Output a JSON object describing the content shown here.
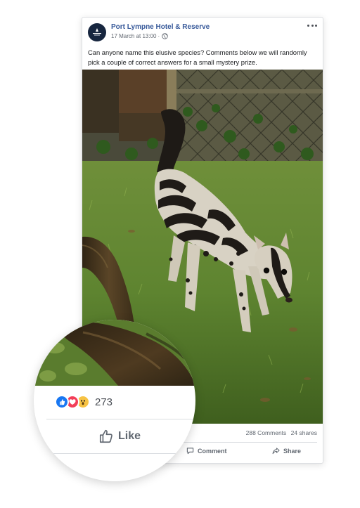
{
  "post": {
    "page_name": "Port Lympne Hotel & Reserve",
    "timestamp": "17 March at 13:00",
    "separator": "·",
    "privacy_icon": "globe-icon",
    "menu_icon": "more-options-icon",
    "text": "Can anyone name this elusive species? Comments below we will randomly pick a couple of correct answers for a small mystery prize.",
    "image_subject": "banded-civet-photo"
  },
  "engagement": {
    "comments": "288 Comments",
    "shares": "24 shares",
    "reaction_count": "273",
    "reactions": [
      "like",
      "love",
      "wow"
    ]
  },
  "actions": {
    "like_label": "Like",
    "comment_label": "Comment",
    "share_label": "Share"
  },
  "colors": {
    "page_name": "#365899",
    "like_blue": "#1877f2",
    "love_red": "#f33e58",
    "wow_yellow": "#f7c344",
    "action_gray": "#606770"
  }
}
